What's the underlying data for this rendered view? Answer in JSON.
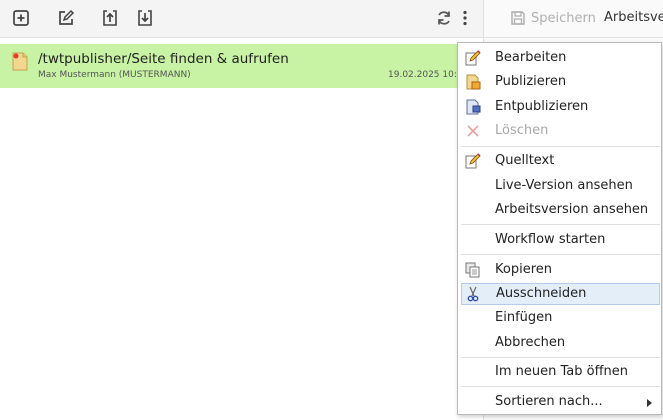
{
  "toolbar": {
    "buttons": [
      {
        "name": "add-icon"
      },
      {
        "name": "edit-icon"
      },
      {
        "name": "upload-icon"
      },
      {
        "name": "download-icon"
      }
    ],
    "refresh_icon": "refresh-icon",
    "more_icon": "more-vertical-icon"
  },
  "right_pane": {
    "save_label": "Speichern",
    "version_label": "Arbeitsvers"
  },
  "list": {
    "items": [
      {
        "title": "/twtpublisher/Seite finden & aufrufen",
        "user": "Max Mustermann (MUSTERMANN)",
        "date": "19.02.2025 10:",
        "icon": "page-icon",
        "selected": true
      }
    ]
  },
  "context_menu": {
    "items": [
      {
        "label": "Bearbeiten",
        "icon": "edit-pencil-icon",
        "disabled": false
      },
      {
        "label": "Publizieren",
        "icon": "publish-icon",
        "disabled": false
      },
      {
        "label": "Entpublizieren",
        "icon": "unpublish-icon",
        "disabled": false
      },
      {
        "label": "Löschen",
        "icon": "delete-icon",
        "disabled": true
      },
      {
        "label": "Quelltext",
        "icon": "source-icon",
        "disabled": false
      },
      {
        "label": "Live-Version ansehen",
        "icon": "",
        "disabled": false
      },
      {
        "label": "Arbeitsversion ansehen",
        "icon": "",
        "disabled": false
      },
      {
        "label": "Workflow starten",
        "icon": "",
        "disabled": false
      },
      {
        "label": "Kopieren",
        "icon": "copy-icon",
        "disabled": false
      },
      {
        "label": "Ausschneiden",
        "icon": "scissors-icon",
        "disabled": false,
        "hovered": true
      },
      {
        "label": "Einfügen",
        "icon": "",
        "disabled": false
      },
      {
        "label": "Abbrechen",
        "icon": "",
        "disabled": false
      },
      {
        "label": "Im neuen Tab öffnen",
        "icon": "",
        "disabled": false
      },
      {
        "label": "Sortieren nach...",
        "icon": "",
        "disabled": false,
        "submenu": true
      }
    ]
  },
  "colors": {
    "selected_row": "#c8f2a4",
    "hover": "#e3eef9",
    "disabled_text": "#a8a8a8"
  }
}
